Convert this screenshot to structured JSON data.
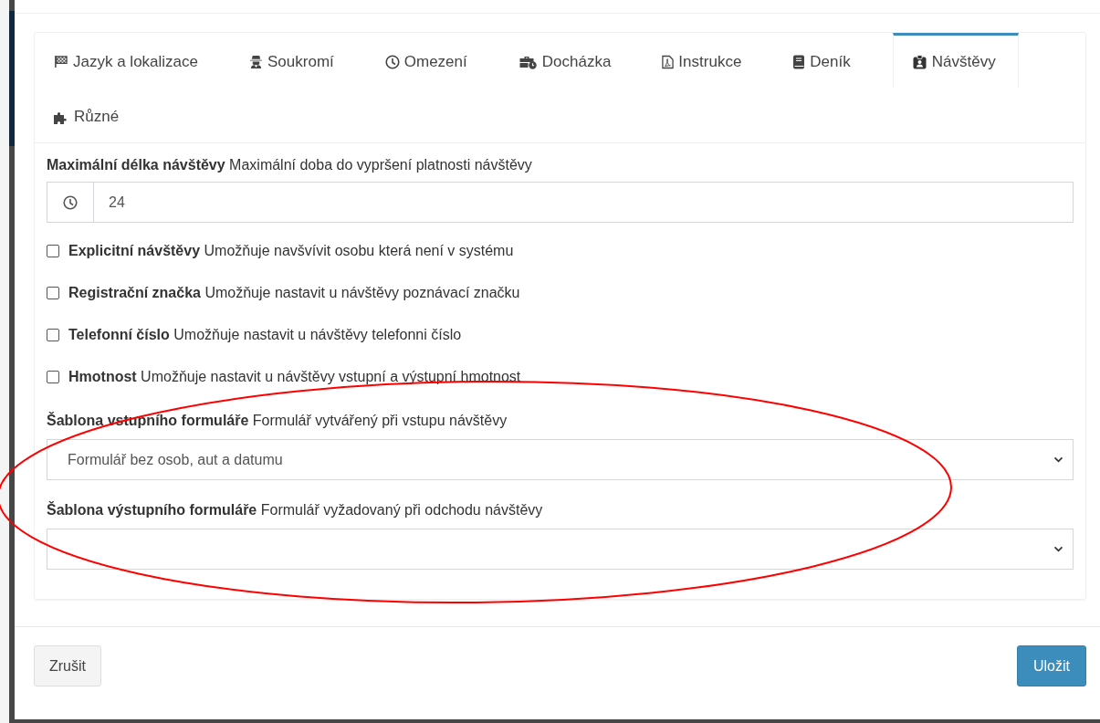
{
  "tabs": [
    {
      "label": "Jazyk a lokalizace",
      "selected": false
    },
    {
      "label": "Soukromí",
      "selected": false
    },
    {
      "label": "Omezení",
      "selected": false
    },
    {
      "label": "Docházka",
      "selected": false
    },
    {
      "label": "Instrukce",
      "selected": false
    },
    {
      "label": "Deník",
      "selected": false
    },
    {
      "label": "Návštěvy",
      "selected": true
    },
    {
      "label": "Různé",
      "selected": false
    }
  ],
  "duration": {
    "label": "**Maximální délka návštěvy** Maximální doba do vypršení platnosti návštěvy",
    "value": "24"
  },
  "options": [
    {
      "label": "**Explicitní návštěvy** Umožňuje navšvívit osobu která není v systému",
      "checked": false
    },
    {
      "label": "**Registrační značka** Umožňuje nastavit u návštěvy poznávací značku",
      "checked": false
    },
    {
      "label": "**Telefonní číslo** Umožňuje nastavit u návštěvy telefonni číslo",
      "checked": false
    },
    {
      "label": "**Hmotnost** Umožňuje nastavit u návštěvy vstupní a výstupní hmotnost",
      "checked": false
    }
  ],
  "templates": [
    {
      "label": "**Šablona vstupního formuláře** Formulář vytvářený při vstupu návštěvy",
      "value": "Formulář bez osob, aut a datumu"
    },
    {
      "label": "**Šablona výstupního formuláře** Formulář vyžadovaný při odchodu návštěvy"
    }
  ],
  "buttons": [
    {
      "label": "Zrušit",
      "kind": "default"
    },
    {
      "label": "Uložit",
      "kind": "primary"
    }
  ],
  "annotation": {
    "kind": "ellipse",
    "color": "#ff0000"
  }
}
